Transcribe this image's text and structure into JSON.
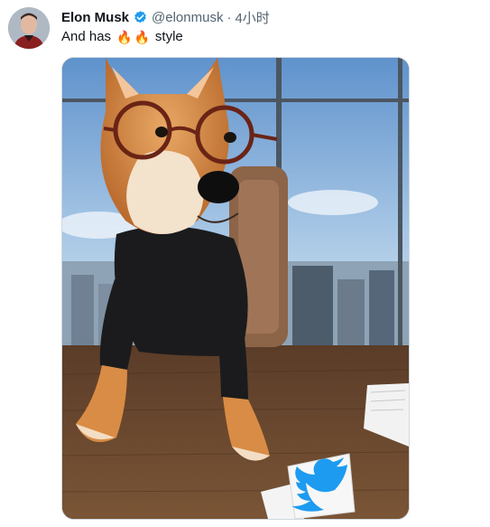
{
  "tweet": {
    "author_name": "Elon Musk",
    "handle": "@elonmusk",
    "separator": "·",
    "time": "4小时",
    "text_before": "And has",
    "emoji": "🔥",
    "text_after": "style"
  },
  "icons": {
    "verified": "verified-badge-icon",
    "twitter_logo": "twitter-bird-icon"
  },
  "colors": {
    "verified_blue": "#1d9bf0",
    "handle_gray": "#536471"
  }
}
